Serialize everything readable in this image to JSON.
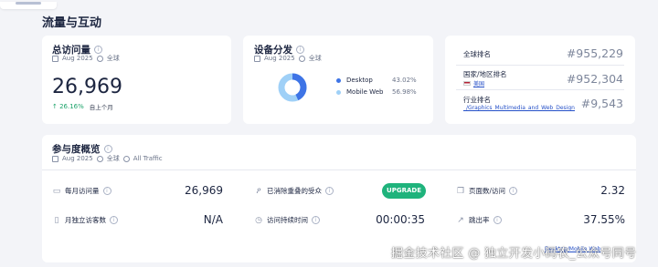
{
  "section_title": "流量与互动",
  "visits_card": {
    "title": "总访问量",
    "date": "Aug 2025",
    "region": "全球",
    "value": "26,969",
    "change": "↑ 26.16%",
    "change_label": "自上个月"
  },
  "device_card": {
    "title": "设备分发",
    "date": "Aug 2025",
    "region": "全球",
    "desktop_label": "Desktop",
    "desktop_pct": "43.02%",
    "mobile_label": "Mobile Web",
    "mobile_pct": "56.98%",
    "desktop_share": 0.4302,
    "colors": {
      "desktop": "#3e74e6",
      "mobile": "#9fd0f7"
    }
  },
  "rank_card": {
    "global_label": "全球排名",
    "global_value": "#955,229",
    "country_label": "国家/地区排名",
    "country_name": "美国",
    "country_value": "#952,304",
    "industry_label": "行业排名",
    "industry_link": "_/Graphics_Multimedia_and_Web_Design",
    "industry_value": "#9,543"
  },
  "engagement": {
    "title": "参与度概览",
    "date": "Aug 2025",
    "region": "全球",
    "traffic": "All Traffic",
    "monthly_visits_label": "每月访问量",
    "monthly_visits_value": "26,969",
    "unique_visitors_label": "月独立访客数",
    "unique_visitors_value": "N/A",
    "dedup_label": "已消除重叠的受众",
    "upgrade_label": "UPGRADE",
    "duration_label": "访问持续时间",
    "duration_value": "00:00:35",
    "pages_label": "页面数/访问",
    "pages_value": "2.32",
    "bounce_label": "跳出率",
    "bounce_value": "37.55%"
  },
  "watermark": {
    "text": "掘金技术社区 @ 独立开发小码农_公众号同号",
    "link": "Desktop/Mobile Web"
  },
  "icons": [
    "info-icon",
    "calendar-icon",
    "globe-icon",
    "flag-icon",
    "audience-icon",
    "clock-icon",
    "pages-icon",
    "bounce-icon"
  ]
}
